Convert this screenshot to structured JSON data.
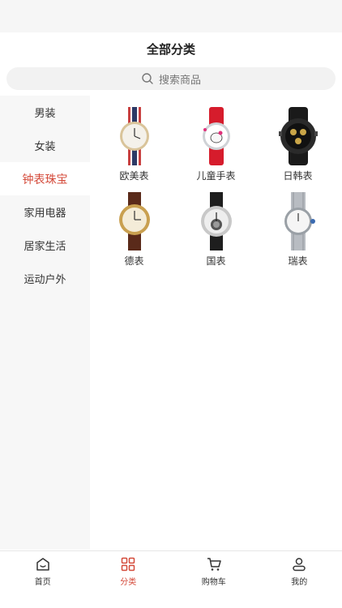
{
  "header": {
    "title": "全部分类"
  },
  "search": {
    "placeholder": "搜索商品"
  },
  "sidebar": {
    "items": [
      {
        "label": "男装",
        "active": false
      },
      {
        "label": "女装",
        "active": false
      },
      {
        "label": "钟表珠宝",
        "active": true
      },
      {
        "label": "家用电器",
        "active": false
      },
      {
        "label": "居家生活",
        "active": false
      },
      {
        "label": "运动户外",
        "active": false
      }
    ]
  },
  "categories": [
    {
      "label": "欧美表",
      "icon": "strap-watch-image"
    },
    {
      "label": "儿童手表",
      "icon": "kids-watch-image"
    },
    {
      "label": "日韩表",
      "icon": "sport-watch-image"
    },
    {
      "label": "德表",
      "icon": "gold-watch-image"
    },
    {
      "label": "国表",
      "icon": "skeleton-watch-image"
    },
    {
      "label": "瑞表",
      "icon": "steel-watch-image"
    }
  ],
  "tabbar": {
    "items": [
      {
        "label": "首页",
        "icon": "home-icon",
        "active": false
      },
      {
        "label": "分类",
        "icon": "category-icon",
        "active": true
      },
      {
        "label": "购物车",
        "icon": "cart-icon",
        "active": false
      },
      {
        "label": "我的",
        "icon": "profile-icon",
        "active": false
      }
    ]
  },
  "colors": {
    "accent": "#d44a3a",
    "sidebar_bg": "#f7f7f7"
  }
}
